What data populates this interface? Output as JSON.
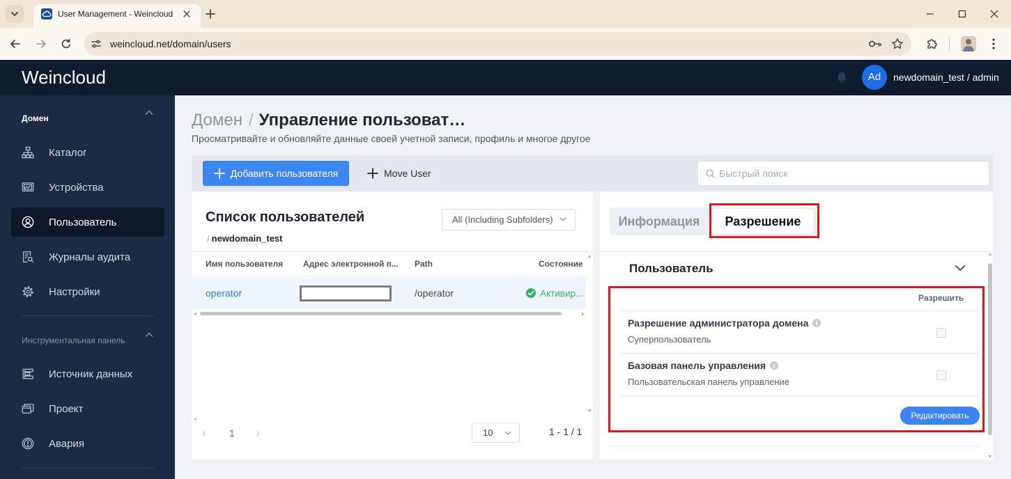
{
  "browser": {
    "tab_title": "User Management - Weincloud",
    "url": "weincloud.net/domain/users"
  },
  "header": {
    "logo": "Weincloud",
    "avatar_initials": "Ad",
    "account": "newdomain_test / admin"
  },
  "sidebar": {
    "domain_section": "Домен",
    "domain_items": [
      {
        "label": "Каталог",
        "icon": "sitemap-icon",
        "active": false
      },
      {
        "label": "Устройства",
        "icon": "devices-icon",
        "active": false
      },
      {
        "label": "Пользователь",
        "icon": "user-circle-icon",
        "active": true
      },
      {
        "label": "Журналы аудита",
        "icon": "audit-log-icon",
        "active": false
      },
      {
        "label": "Настройки",
        "icon": "gear-icon",
        "active": false
      }
    ],
    "dashboard_section": "Инструментальная панель",
    "dashboard_items": [
      {
        "label": "Источник данных",
        "icon": "data-source-icon",
        "active": false
      },
      {
        "label": "Проект",
        "icon": "project-icon",
        "active": false
      },
      {
        "label": "Авария",
        "icon": "alarm-icon",
        "active": false
      }
    ]
  },
  "page": {
    "breadcrumb_root": "Домен",
    "breadcrumb_separator": "/",
    "title": "Управление пользоват…",
    "subtitle": "Просматривайте и обновляйте данные своей учетной записи, профиль и многое другое"
  },
  "toolbar": {
    "add_user_label": "Добавить пользователя",
    "move_user_label": "Move User",
    "search_placeholder": "Быстрый поиск"
  },
  "user_list": {
    "title": "Список пользователей",
    "path_separator": "/",
    "path": "newdomain_test",
    "scope": "All (Including Subfolders)",
    "columns": [
      "Имя пользователя",
      "Адрес электронной п...",
      "Path",
      "Состояние"
    ],
    "rows": [
      {
        "username": "operator",
        "email_redacted": true,
        "path": "/operator",
        "status": "Активир..."
      }
    ],
    "pagination": {
      "prev": "‹",
      "current_page": "1",
      "next": "›",
      "page_size": "10",
      "range": "1 - 1 / 1"
    }
  },
  "detail": {
    "tabs": [
      {
        "label": "Информация",
        "active": false
      },
      {
        "label": "Разрешение",
        "active": true
      }
    ],
    "user_section": {
      "title": "Пользователь",
      "allow_header": "Разрешить",
      "permissions": [
        {
          "name": "Разрешение администратора домена",
          "description": "Суперпользователь",
          "checked": false
        },
        {
          "name": "Базовая панель управления",
          "description": "Пользовательская панель управление",
          "checked": false
        }
      ],
      "edit_button": "Редактировать"
    }
  },
  "colors": {
    "primary": "#3c86f2",
    "header_bg": "#0f1b2e",
    "sidebar_bg": "#1c2a43",
    "sidebar_active_bg": "#0e1829",
    "highlight_annotation": "#e0161f",
    "status_active": "#3cb06a",
    "selected_row": "#eef5fe"
  }
}
